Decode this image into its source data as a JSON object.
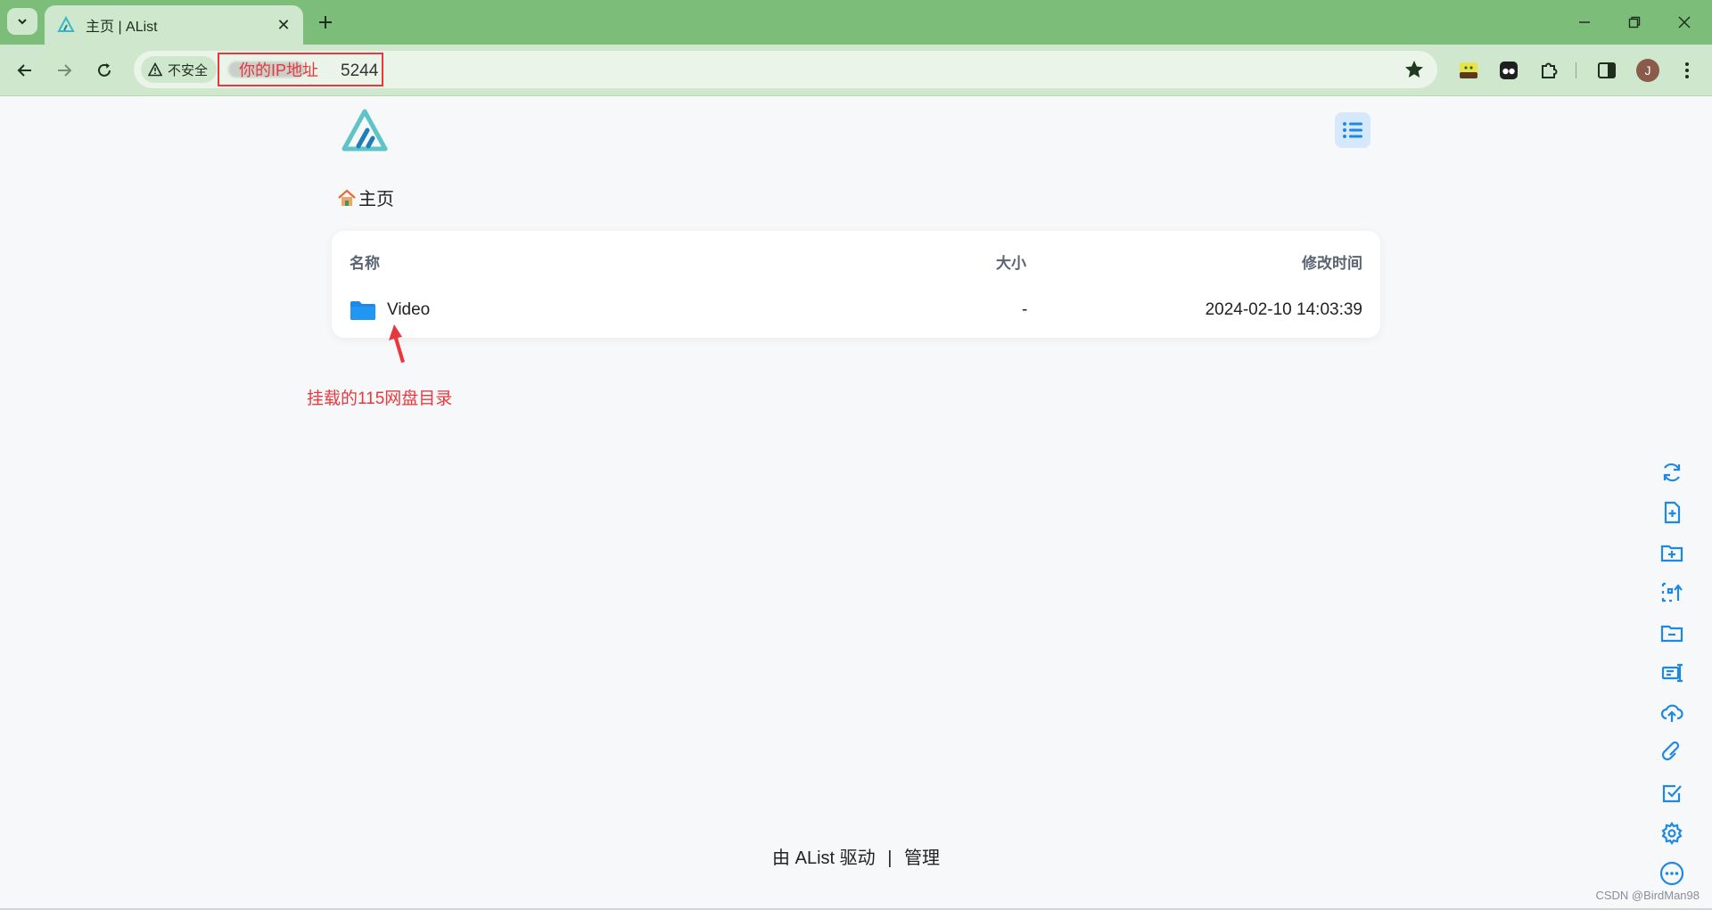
{
  "browser": {
    "tab_title": "主页 | AList",
    "security_label": "不安全",
    "url_annotation": "你的IP地址",
    "url_port": "5244",
    "profile_initial": "J"
  },
  "page": {
    "breadcrumb_home": "主页",
    "table": {
      "headers": {
        "name": "名称",
        "size": "大小",
        "modified": "修改时间"
      },
      "rows": [
        {
          "name": "Video",
          "size": "-",
          "modified": "2024-02-10 14:03:39"
        }
      ]
    },
    "annotation": "挂载的115网盘目录",
    "footer": {
      "powered_by": "由 AList 驱动",
      "separator": "|",
      "manage": "管理"
    }
  },
  "watermark": "CSDN @BirdMan98",
  "colors": {
    "title_bar": "#7dbd7a",
    "toolbar": "#cfe7cc",
    "accent": "#1e88e5",
    "annotation_red": "#e8383d",
    "page_bg": "#f7f8fa"
  },
  "side_tools": [
    "refresh-icon",
    "new-file-icon",
    "new-folder-icon",
    "batch-rename-icon",
    "move-icon",
    "copy-icon",
    "upload-icon",
    "offline-download-icon",
    "select-mode-icon",
    "settings-icon",
    "more-icon"
  ]
}
